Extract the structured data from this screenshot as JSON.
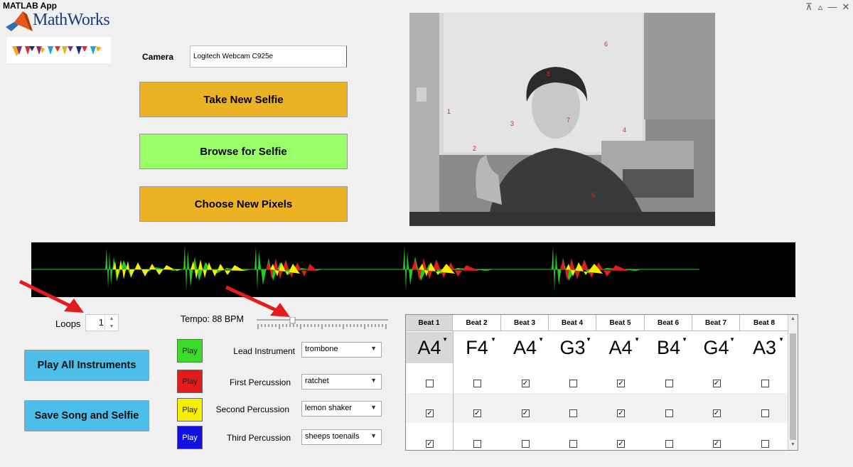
{
  "window": {
    "title": "MATLAB App",
    "controls": [
      "⊼",
      "▵",
      "—",
      "□",
      "✕"
    ]
  },
  "logo": {
    "brand": "MathWorks"
  },
  "camera": {
    "label": "Camera",
    "value": "Logitech Webcam C925e"
  },
  "buttons": {
    "take_selfie": "Take New Selfie",
    "browse_selfie": "Browse for Selfie",
    "choose_pixels": "Choose New Pixels",
    "play_all": "Play All Instruments",
    "save_song": "Save Song and Selfie"
  },
  "photo_points": [
    "1",
    "2",
    "3",
    "4",
    "5",
    "6",
    "7",
    "8"
  ],
  "loops": {
    "label": "Loops",
    "value": "1"
  },
  "tempo": {
    "label": "Tempo: 88 BPM",
    "value_fraction": 0.28
  },
  "instruments": [
    {
      "play": "Play",
      "color": "#3ddc2b",
      "label": "Lead Instrument",
      "value": "trombone"
    },
    {
      "play": "Play",
      "color": "#e41b1b",
      "label": "First Percussion",
      "value": "ratchet"
    },
    {
      "play": "Play",
      "color": "#f5f000",
      "label": "Second Percussion",
      "value": "lemon shaker"
    },
    {
      "play": "Play",
      "color": "#1212e0",
      "label": "Third Percussion",
      "value": "sheeps toenails"
    }
  ],
  "beats": {
    "headers": [
      "Beat 1",
      "Beat 2",
      "Beat 3",
      "Beat 4",
      "Beat 5",
      "Beat 6",
      "Beat 7",
      "Beat 8"
    ],
    "notes": [
      "A4",
      "F4",
      "A4",
      "G3",
      "A4",
      "B4",
      "G4",
      "A3"
    ],
    "rows": [
      [
        false,
        false,
        true,
        false,
        true,
        false,
        true,
        false
      ],
      [
        true,
        true,
        true,
        false,
        true,
        false,
        true,
        false
      ],
      [
        true,
        false,
        false,
        false,
        true,
        false,
        true,
        false
      ]
    ]
  },
  "colors": {
    "orange": "#ebb224",
    "green": "#99ff66",
    "blue": "#4dbeea"
  }
}
